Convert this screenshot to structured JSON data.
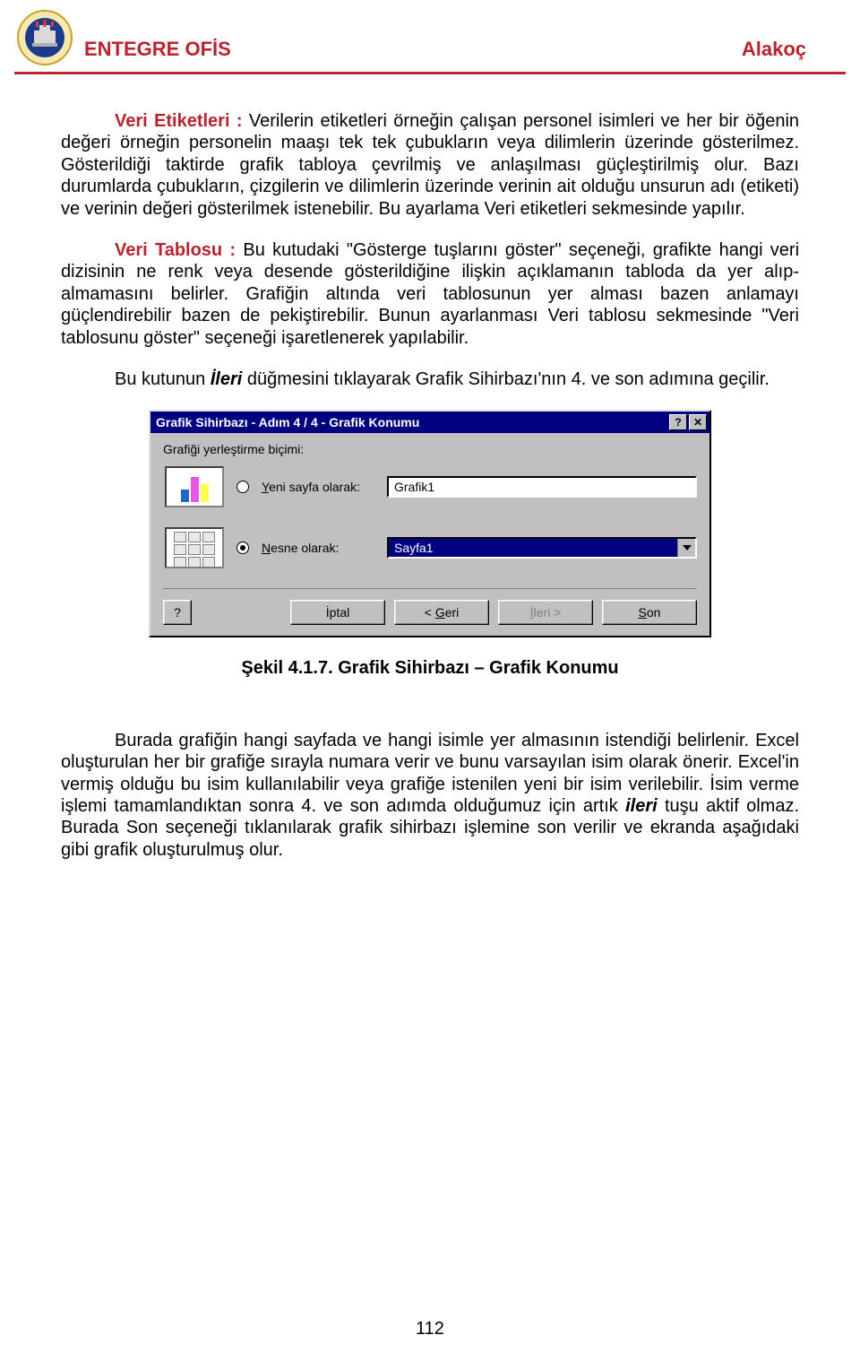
{
  "header": {
    "title": "ENTEGRE OFİS",
    "author": "Alakoç"
  },
  "paragraphs": {
    "p1_lead": "Veri Etiketleri : ",
    "p1_body": "Verilerin etiketleri örneğin çalışan personel isimleri ve her bir öğenin değeri örneğin personelin maaşı tek tek çubukların veya dilimlerin üzerinde gösterilmez. Gösterildiği taktirde grafik tabloya çevrilmiş ve anlaşılması güçleştirilmiş olur. Bazı durumlarda çubukların, çizgilerin ve dilimlerin üzerinde verinin ait olduğu unsurun adı (etiketi) ve verinin değeri gösterilmek istenebilir. Bu ayarlama Veri etiketleri sekmesinde yapılır.",
    "p2_lead": "Veri Tablosu : ",
    "p2_body": "Bu kutudaki \"Gösterge tuşlarını göster\" seçeneği, grafikte hangi veri dizisinin ne renk veya desende gösterildiğine ilişkin açıklamanın tabloda da yer alıp-almamasını belirler. Grafiğin altında veri tablosunun yer alması bazen anlamayı güçlendirebilir bazen de pekiştirebilir. Bunun ayarlanması Veri tablosu sekmesinde \"Veri tablosunu göster\" seçeneği işaretlenerek yapılabilir.",
    "p3_pre": "Bu kutunun ",
    "p3_italic": "İleri",
    "p3_post": " düğmesini tıklayarak Grafik Sihirbazı'nın 4. ve son adımına geçilir.",
    "p4": "Burada grafiğin hangi sayfada ve hangi isimle yer almasının istendiği belirlenir. Excel oluşturulan her bir grafiğe sırayla numara verir ve bunu varsayılan isim olarak önerir. Excel'in vermiş olduğu bu isim kullanılabilir veya grafiğe istenilen yeni bir isim verilebilir. İsim verme işlemi tamamlandıktan sonra 4. ve son adımda olduğumuz için artık ",
    "p4_italic": "ileri",
    "p4_post": " tuşu aktif olmaz. Burada Son seçeneği tıklanılarak grafik sihirbazı işlemine son verilir ve ekranda aşağıdaki gibi grafik oluşturulmuş olur."
  },
  "dialog": {
    "title": "Grafik Sihirbazı - Adım 4 / 4 - Grafik Konumu",
    "label": "Grafiği yerleştirme biçimi:",
    "opt1_pre": "Y",
    "opt1_rest": "eni sayfa olarak:",
    "opt1_value": "Grafik1",
    "opt2_pre": "N",
    "opt2_rest": "esne olarak:",
    "opt2_value": "Sayfa1",
    "help_symbol": "?",
    "close_symbol": "✕",
    "btn_cancel": "İptal",
    "btn_back_pre": "< ",
    "btn_back_u": "G",
    "btn_back_rest": "eri",
    "btn_next_pre": "İ",
    "btn_next_rest": "leri >",
    "btn_finish_u": "S",
    "btn_finish_rest": "on"
  },
  "caption": "Şekil 4.1.7. Grafik Sihirbazı – Grafik Konumu",
  "page_number": "112"
}
